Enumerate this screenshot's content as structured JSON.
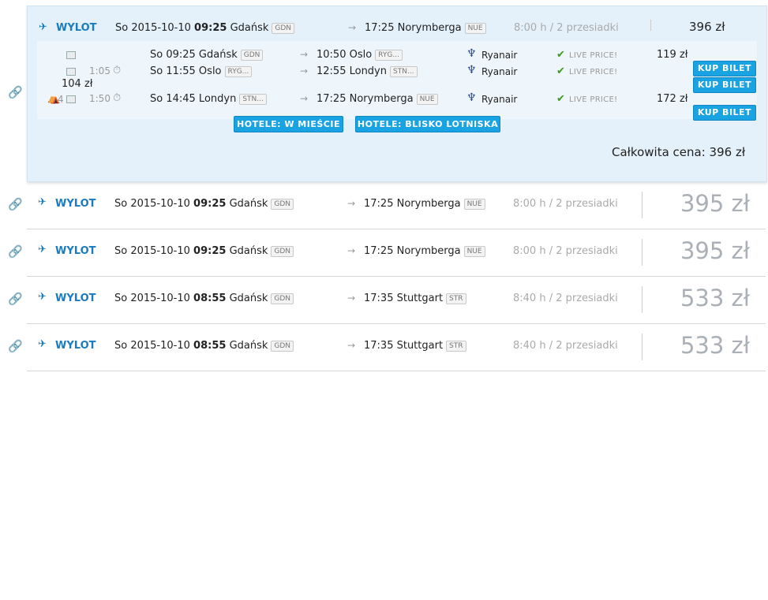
{
  "currency": "zł",
  "expanded": {
    "header": {
      "label": "WYLOT",
      "date": "So 2015-10-10",
      "time": "09:25",
      "from": "Gdańsk",
      "from_code": "GDN",
      "arrive": "17:25 Norymberga",
      "to_code": "NUE",
      "duration": "8:00 h / 2 przesiadki",
      "price": "396 zł"
    },
    "segments": [
      {
        "dep": "So 09:25 Gdańsk",
        "dep_code": "GDN",
        "arr": "10:50 Oslo",
        "arr_code": "RYG...",
        "airline": "Ryanair",
        "live": "LIVE PRICE!",
        "price": "119 zł",
        "buy": "KUP BILET"
      },
      {
        "layover": "1:05",
        "dep": "So 11:55 Oslo",
        "dep_code": "RYG...",
        "arr": "12:55 Londyn",
        "arr_code": "STN...",
        "airline": "Ryanair",
        "live": "LIVE PRICE!",
        "price": "104 zł",
        "buy": "KUP BILET"
      },
      {
        "seats": "4",
        "layover": "1:50",
        "dep": "So 14:45 Londyn",
        "dep_code": "STN...",
        "arr": "17:25 Norymberga",
        "arr_code": "NUE",
        "airline": "Ryanair",
        "live": "LIVE PRICE!",
        "price": "172 zł",
        "buy": "KUP BILET"
      }
    ],
    "hotel_buttons": [
      "HOTELE: W MIEŚCIE",
      "HOTELE: BLISKO LOTNISKA"
    ],
    "total_label": "Całkowita cena:",
    "total_value": "396 zł"
  },
  "results": [
    {
      "label": "WYLOT",
      "date": "So 2015-10-10",
      "time": "09:25",
      "from": "Gdańsk",
      "from_code": "GDN",
      "arrive": "17:25 Norymberga",
      "to_code": "NUE",
      "duration": "8:00 h / 2 przesiadki",
      "price": "395 zł"
    },
    {
      "label": "WYLOT",
      "date": "So 2015-10-10",
      "time": "09:25",
      "from": "Gdańsk",
      "from_code": "GDN",
      "arrive": "17:25 Norymberga",
      "to_code": "NUE",
      "duration": "8:00 h / 2 przesiadki",
      "price": "395 zł"
    },
    {
      "label": "WYLOT",
      "date": "So 2015-10-10",
      "time": "08:55",
      "from": "Gdańsk",
      "from_code": "GDN",
      "arrive": "17:35 Stuttgart",
      "to_code": "STR",
      "duration": "8:40 h / 2 przesiadki",
      "price": "533 zł"
    },
    {
      "label": "WYLOT",
      "date": "So 2015-10-10",
      "time": "08:55",
      "from": "Gdańsk",
      "from_code": "GDN",
      "arrive": "17:35 Stuttgart",
      "to_code": "STR",
      "duration": "8:40 h / 2 przesiadki",
      "price": "533 zł"
    }
  ],
  "icons": {
    "link": "link-icon",
    "plane": "plane-icon",
    "photo": "photo-icon",
    "airline": "ryanair-logo-icon",
    "check": "check-icon",
    "layover": "layover-icon",
    "seat": "seat-icon"
  },
  "colors": {
    "accent": "#1a7cbf",
    "button": "#1aa3e3",
    "check": "#3a9a1d",
    "expanded_bg": "#e4f1fb"
  }
}
